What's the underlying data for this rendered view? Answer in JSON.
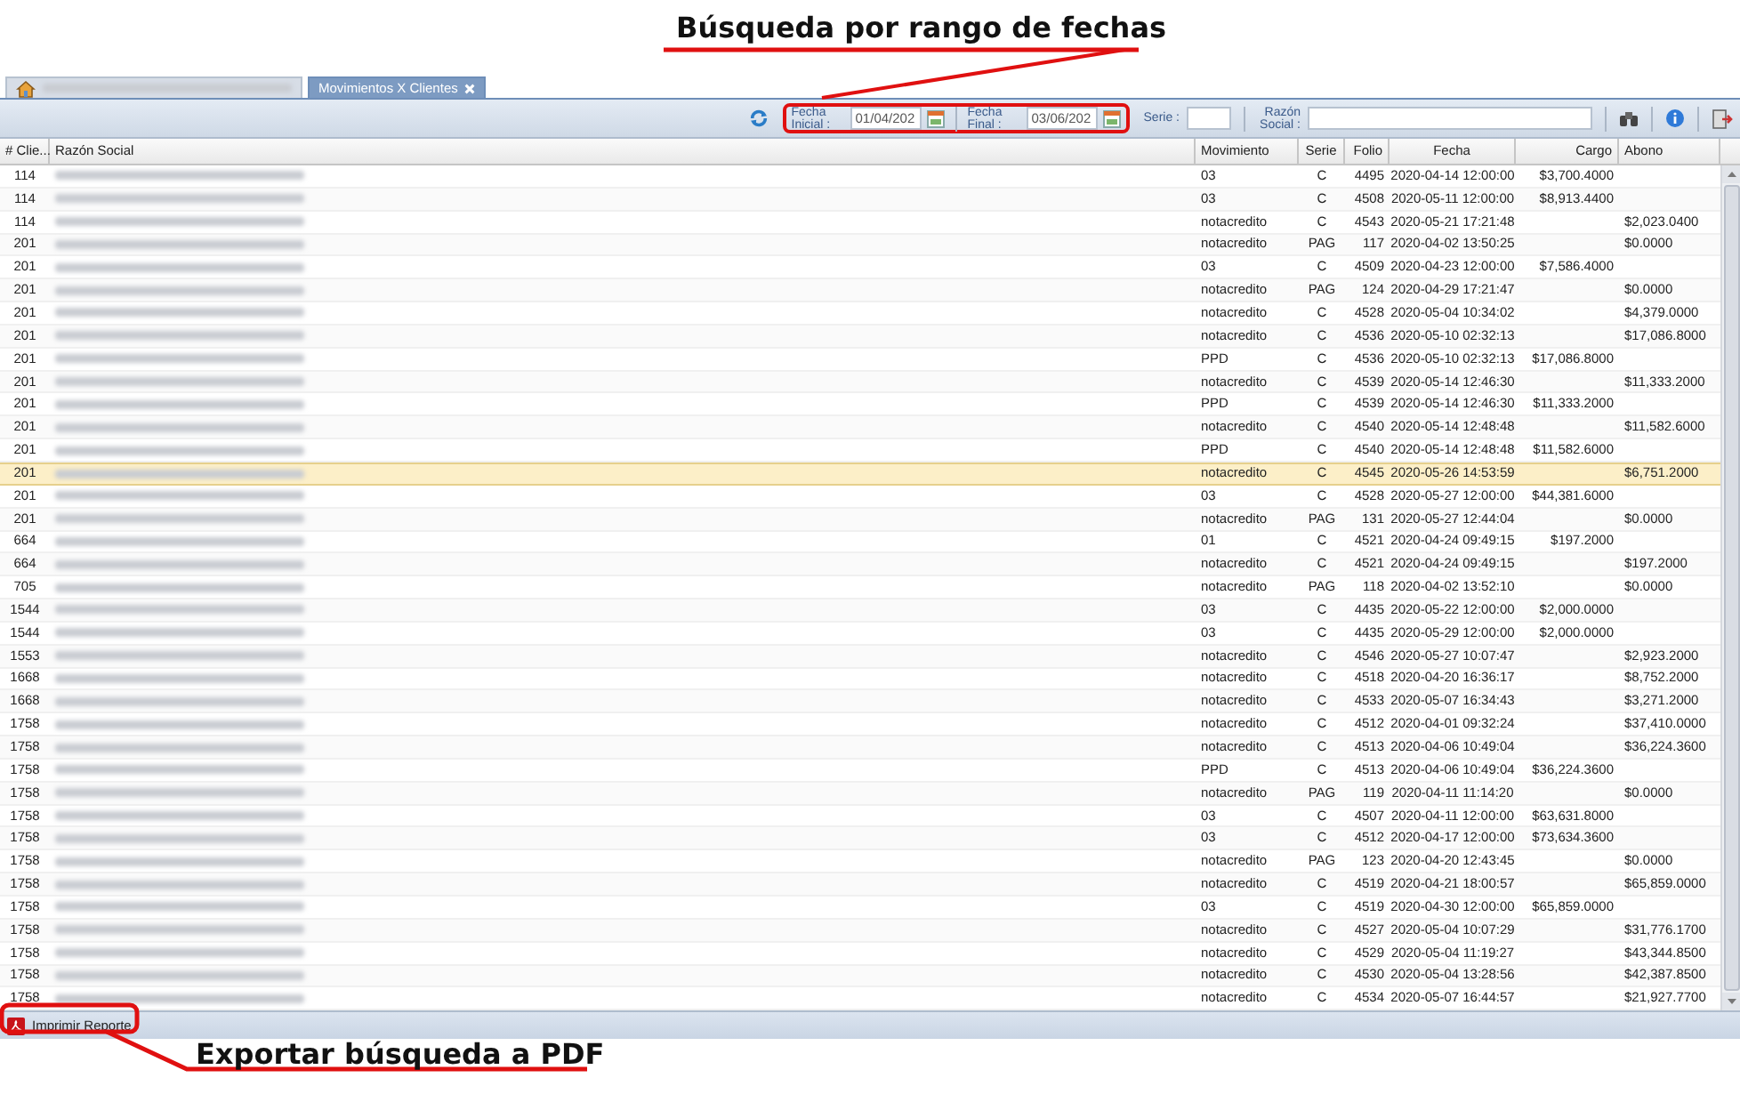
{
  "annotations": [
    {
      "text": "Búsqueda por rango de fechas"
    },
    {
      "text": "Exportar búsqueda a PDF"
    }
  ],
  "tabs": [
    {
      "kind": "home",
      "selected": false
    },
    {
      "kind": "text",
      "label": "Movimientos X Clientes",
      "selected": true
    }
  ],
  "toolbar": {
    "fecha_inicial": {
      "label": "Fecha Inicial :",
      "value": "01/04/202"
    },
    "fecha_final": {
      "label": "Fecha Final :",
      "value": "03/06/202"
    },
    "serie": {
      "label": "Serie :"
    },
    "razon_social": {
      "label": "Razón Social :"
    }
  },
  "table": {
    "columns": [
      {
        "label": "# Clie..."
      },
      {
        "label": "Razón Social"
      },
      {
        "label": "Movimiento"
      },
      {
        "label": "Serie"
      },
      {
        "label": "Folio"
      },
      {
        "label": "Fecha"
      },
      {
        "label": "Cargo"
      },
      {
        "label": "Abono"
      }
    ],
    "rows": [
      {
        "cliente": "114",
        "movimiento": "03",
        "serie": "C",
        "folio": "4495",
        "fecha": "2020-04-14 12:00:00",
        "cargo": "$3,700.4000",
        "abono": "",
        "selected": false
      },
      {
        "cliente": "114",
        "movimiento": "03",
        "serie": "C",
        "folio": "4508",
        "fecha": "2020-05-11 12:00:00",
        "cargo": "$8,913.4400",
        "abono": "",
        "selected": false
      },
      {
        "cliente": "114",
        "movimiento": "notacredito",
        "serie": "C",
        "folio": "4543",
        "fecha": "2020-05-21 17:21:48",
        "cargo": "",
        "abono": "$2,023.0400",
        "selected": false
      },
      {
        "cliente": "201",
        "movimiento": "notacredito",
        "serie": "PAG",
        "folio": "117",
        "fecha": "2020-04-02 13:50:25",
        "cargo": "",
        "abono": "$0.0000",
        "selected": false
      },
      {
        "cliente": "201",
        "movimiento": "03",
        "serie": "C",
        "folio": "4509",
        "fecha": "2020-04-23 12:00:00",
        "cargo": "$7,586.4000",
        "abono": "",
        "selected": false
      },
      {
        "cliente": "201",
        "movimiento": "notacredito",
        "serie": "PAG",
        "folio": "124",
        "fecha": "2020-04-29 17:21:47",
        "cargo": "",
        "abono": "$0.0000",
        "selected": false
      },
      {
        "cliente": "201",
        "movimiento": "notacredito",
        "serie": "C",
        "folio": "4528",
        "fecha": "2020-05-04 10:34:02",
        "cargo": "",
        "abono": "$4,379.0000",
        "selected": false
      },
      {
        "cliente": "201",
        "movimiento": "notacredito",
        "serie": "C",
        "folio": "4536",
        "fecha": "2020-05-10 02:32:13",
        "cargo": "",
        "abono": "$17,086.8000",
        "selected": false
      },
      {
        "cliente": "201",
        "movimiento": "PPD",
        "serie": "C",
        "folio": "4536",
        "fecha": "2020-05-10 02:32:13",
        "cargo": "$17,086.8000",
        "abono": "",
        "selected": false
      },
      {
        "cliente": "201",
        "movimiento": "notacredito",
        "serie": "C",
        "folio": "4539",
        "fecha": "2020-05-14 12:46:30",
        "cargo": "",
        "abono": "$11,333.2000",
        "selected": false
      },
      {
        "cliente": "201",
        "movimiento": "PPD",
        "serie": "C",
        "folio": "4539",
        "fecha": "2020-05-14 12:46:30",
        "cargo": "$11,333.2000",
        "abono": "",
        "selected": false
      },
      {
        "cliente": "201",
        "movimiento": "notacredito",
        "serie": "C",
        "folio": "4540",
        "fecha": "2020-05-14 12:48:48",
        "cargo": "",
        "abono": "$11,582.6000",
        "selected": false
      },
      {
        "cliente": "201",
        "movimiento": "PPD",
        "serie": "C",
        "folio": "4540",
        "fecha": "2020-05-14 12:48:48",
        "cargo": "$11,582.6000",
        "abono": "",
        "selected": false
      },
      {
        "cliente": "201",
        "movimiento": "notacredito",
        "serie": "C",
        "folio": "4545",
        "fecha": "2020-05-26 14:53:59",
        "cargo": "",
        "abono": "$6,751.2000",
        "selected": true
      },
      {
        "cliente": "201",
        "movimiento": "03",
        "serie": "C",
        "folio": "4528",
        "fecha": "2020-05-27 12:00:00",
        "cargo": "$44,381.6000",
        "abono": "",
        "selected": false
      },
      {
        "cliente": "201",
        "movimiento": "notacredito",
        "serie": "PAG",
        "folio": "131",
        "fecha": "2020-05-27 12:44:04",
        "cargo": "",
        "abono": "$0.0000",
        "selected": false
      },
      {
        "cliente": "664",
        "movimiento": "01",
        "serie": "C",
        "folio": "4521",
        "fecha": "2020-04-24 09:49:15",
        "cargo": "$197.2000",
        "abono": "",
        "selected": false
      },
      {
        "cliente": "664",
        "movimiento": "notacredito",
        "serie": "C",
        "folio": "4521",
        "fecha": "2020-04-24 09:49:15",
        "cargo": "",
        "abono": "$197.2000",
        "selected": false
      },
      {
        "cliente": "705",
        "movimiento": "notacredito",
        "serie": "PAG",
        "folio": "118",
        "fecha": "2020-04-02 13:52:10",
        "cargo": "",
        "abono": "$0.0000",
        "selected": false
      },
      {
        "cliente": "1544",
        "movimiento": "03",
        "serie": "C",
        "folio": "4435",
        "fecha": "2020-05-22 12:00:00",
        "cargo": "$2,000.0000",
        "abono": "",
        "selected": false
      },
      {
        "cliente": "1544",
        "movimiento": "03",
        "serie": "C",
        "folio": "4435",
        "fecha": "2020-05-29 12:00:00",
        "cargo": "$2,000.0000",
        "abono": "",
        "selected": false
      },
      {
        "cliente": "1553",
        "movimiento": "notacredito",
        "serie": "C",
        "folio": "4546",
        "fecha": "2020-05-27 10:07:47",
        "cargo": "",
        "abono": "$2,923.2000",
        "selected": false
      },
      {
        "cliente": "1668",
        "movimiento": "notacredito",
        "serie": "C",
        "folio": "4518",
        "fecha": "2020-04-20 16:36:17",
        "cargo": "",
        "abono": "$8,752.2000",
        "selected": false
      },
      {
        "cliente": "1668",
        "movimiento": "notacredito",
        "serie": "C",
        "folio": "4533",
        "fecha": "2020-05-07 16:34:43",
        "cargo": "",
        "abono": "$3,271.2000",
        "selected": false
      },
      {
        "cliente": "1758",
        "movimiento": "notacredito",
        "serie": "C",
        "folio": "4512",
        "fecha": "2020-04-01 09:32:24",
        "cargo": "",
        "abono": "$37,410.0000",
        "selected": false
      },
      {
        "cliente": "1758",
        "movimiento": "notacredito",
        "serie": "C",
        "folio": "4513",
        "fecha": "2020-04-06 10:49:04",
        "cargo": "",
        "abono": "$36,224.3600",
        "selected": false
      },
      {
        "cliente": "1758",
        "movimiento": "PPD",
        "serie": "C",
        "folio": "4513",
        "fecha": "2020-04-06 10:49:04",
        "cargo": "$36,224.3600",
        "abono": "",
        "selected": false
      },
      {
        "cliente": "1758",
        "movimiento": "notacredito",
        "serie": "PAG",
        "folio": "119",
        "fecha": "2020-04-11 11:14:20",
        "cargo": "",
        "abono": "$0.0000",
        "selected": false
      },
      {
        "cliente": "1758",
        "movimiento": "03",
        "serie": "C",
        "folio": "4507",
        "fecha": "2020-04-11 12:00:00",
        "cargo": "$63,631.8000",
        "abono": "",
        "selected": false
      },
      {
        "cliente": "1758",
        "movimiento": "03",
        "serie": "C",
        "folio": "4512",
        "fecha": "2020-04-17 12:00:00",
        "cargo": "$73,634.3600",
        "abono": "",
        "selected": false
      },
      {
        "cliente": "1758",
        "movimiento": "notacredito",
        "serie": "PAG",
        "folio": "123",
        "fecha": "2020-04-20 12:43:45",
        "cargo": "",
        "abono": "$0.0000",
        "selected": false
      },
      {
        "cliente": "1758",
        "movimiento": "notacredito",
        "serie": "C",
        "folio": "4519",
        "fecha": "2020-04-21 18:00:57",
        "cargo": "",
        "abono": "$65,859.0000",
        "selected": false
      },
      {
        "cliente": "1758",
        "movimiento": "03",
        "serie": "C",
        "folio": "4519",
        "fecha": "2020-04-30 12:00:00",
        "cargo": "$65,859.0000",
        "abono": "",
        "selected": false
      },
      {
        "cliente": "1758",
        "movimiento": "notacredito",
        "serie": "C",
        "folio": "4527",
        "fecha": "2020-05-04 10:07:29",
        "cargo": "",
        "abono": "$31,776.1700",
        "selected": false
      },
      {
        "cliente": "1758",
        "movimiento": "notacredito",
        "serie": "C",
        "folio": "4529",
        "fecha": "2020-05-04 11:19:27",
        "cargo": "",
        "abono": "$43,344.8500",
        "selected": false
      },
      {
        "cliente": "1758",
        "movimiento": "notacredito",
        "serie": "C",
        "folio": "4530",
        "fecha": "2020-05-04 13:28:56",
        "cargo": "",
        "abono": "$42,387.8500",
        "selected": false
      },
      {
        "cliente": "1758",
        "movimiento": "notacredito",
        "serie": "C",
        "folio": "4534",
        "fecha": "2020-05-07 16:44:57",
        "cargo": "",
        "abono": "$21,927.7700",
        "selected": false
      }
    ]
  },
  "footer": {
    "button": "Imprimir Reporte"
  }
}
